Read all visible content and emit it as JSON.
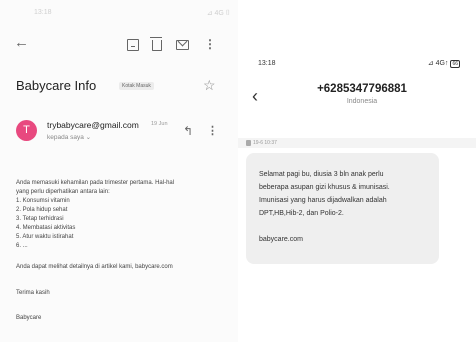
{
  "email_app": {
    "status_time": "13:18",
    "status_signal": "⊿ 4G ⌷",
    "subject": "Babycare Info",
    "label": "Kotak Masuk",
    "avatar_letter": "T",
    "sender": "trybabycare@gmail.com",
    "date": "19 Jun",
    "recipient": "kepada saya ⌄",
    "body_lines": [
      "Anda memasuki kehamilan pada trimester pertama. Hal-hal",
      "yang perlu diperhatikan antara lain:",
      "1. Konsumsi vitamin",
      "2. Pola hidup sehat",
      "3. Tetap terhidrasi",
      "4. Membatasi aktivitas",
      "5. Atur waktu istirahat",
      "6. ..."
    ],
    "article_line": "Anda dapat melihat detailnya di artikel kami, babycare.com",
    "thanks": "Terima kasih",
    "signature": "Babycare"
  },
  "sms_app": {
    "status_time": "13:18",
    "status_signal": "⊿ 4G↑",
    "battery": "66",
    "contact_number": "+6285347796881",
    "contact_country": "Indonesia",
    "message_date": "19-6 10:37",
    "message_lines": [
      "Selamat pagi bu, diusia 3 bln anak perlu",
      "beberapa asupan gizi khusus & imunisasi.",
      "Imunisasi yang harus dijadwalkan adalah",
      "DPT,HB,Hib-2, dan Polio-2."
    ],
    "message_link": "babycare.com"
  },
  "icons": [
    "back-arrow-icon",
    "archive-icon",
    "trash-icon",
    "mail-icon",
    "kebab-menu-icon",
    "star-icon",
    "reply-icon",
    "sim-icon"
  ],
  "colors": {
    "avatar": "#e8497f",
    "bubble": "#efefef"
  }
}
